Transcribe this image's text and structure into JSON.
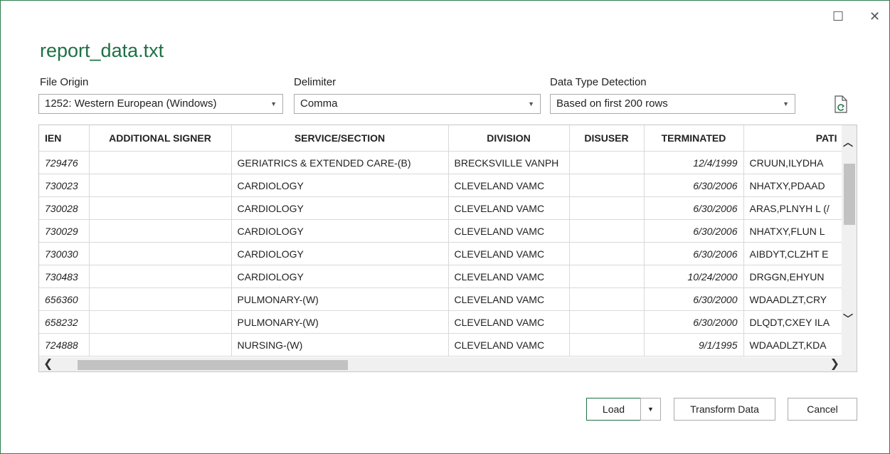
{
  "window": {
    "maximize_icon": "maximize-icon",
    "close_icon": "close-icon",
    "maximize_glyph": "☐",
    "close_glyph": "✕"
  },
  "title": "report_data.txt",
  "options": {
    "file_origin": {
      "label": "File Origin",
      "value": "1252: Western European (Windows)"
    },
    "delimiter": {
      "label": "Delimiter",
      "value": "Comma"
    },
    "data_type_detection": {
      "label": "Data Type Detection",
      "value": "Based on first 200 rows"
    },
    "refresh_icon": "refresh-file-icon"
  },
  "table": {
    "columns": [
      "IEN",
      "ADDITIONAL SIGNER",
      "SERVICE/SECTION",
      "DIVISION",
      "DISUSER",
      "TERMINATED",
      "PATI"
    ],
    "rows": [
      [
        "729476",
        "",
        "GERIATRICS & EXTENDED CARE-(B)",
        "BRECKSVILLE VANPH",
        "",
        "12/4/1999",
        "CRUUN,ILYDHA"
      ],
      [
        "730023",
        "",
        "CARDIOLOGY",
        "CLEVELAND VAMC",
        "",
        "6/30/2006",
        "NHATXY,PDAAD"
      ],
      [
        "730028",
        "",
        "CARDIOLOGY",
        "CLEVELAND VAMC",
        "",
        "6/30/2006",
        "ARAS,PLNYH L (/"
      ],
      [
        "730029",
        "",
        "CARDIOLOGY",
        "CLEVELAND VAMC",
        "",
        "6/30/2006",
        "NHATXY,FLUN L"
      ],
      [
        "730030",
        "",
        "CARDIOLOGY",
        "CLEVELAND VAMC",
        "",
        "6/30/2006",
        "AIBDYT,CLZHT E"
      ],
      [
        "730483",
        "",
        "CARDIOLOGY",
        "CLEVELAND VAMC",
        "",
        "10/24/2000",
        "DRGGN,EHYUN"
      ],
      [
        "656360",
        "",
        "PULMONARY-(W)",
        "CLEVELAND VAMC",
        "",
        "6/30/2000",
        "WDAADLZT,CRY"
      ],
      [
        "658232",
        "",
        "PULMONARY-(W)",
        "CLEVELAND VAMC",
        "",
        "6/30/2000",
        "DLQDT,CXEY ILA"
      ],
      [
        "724888",
        "",
        "NURSING-(W)",
        "CLEVELAND VAMC",
        "",
        "9/1/1995",
        "WDAADLZT,KDA"
      ]
    ]
  },
  "buttons": {
    "load": "Load",
    "transform": "Transform Data",
    "cancel": "Cancel"
  },
  "colors": {
    "accent": "#1e7145",
    "frame": "#2e7d4f"
  }
}
